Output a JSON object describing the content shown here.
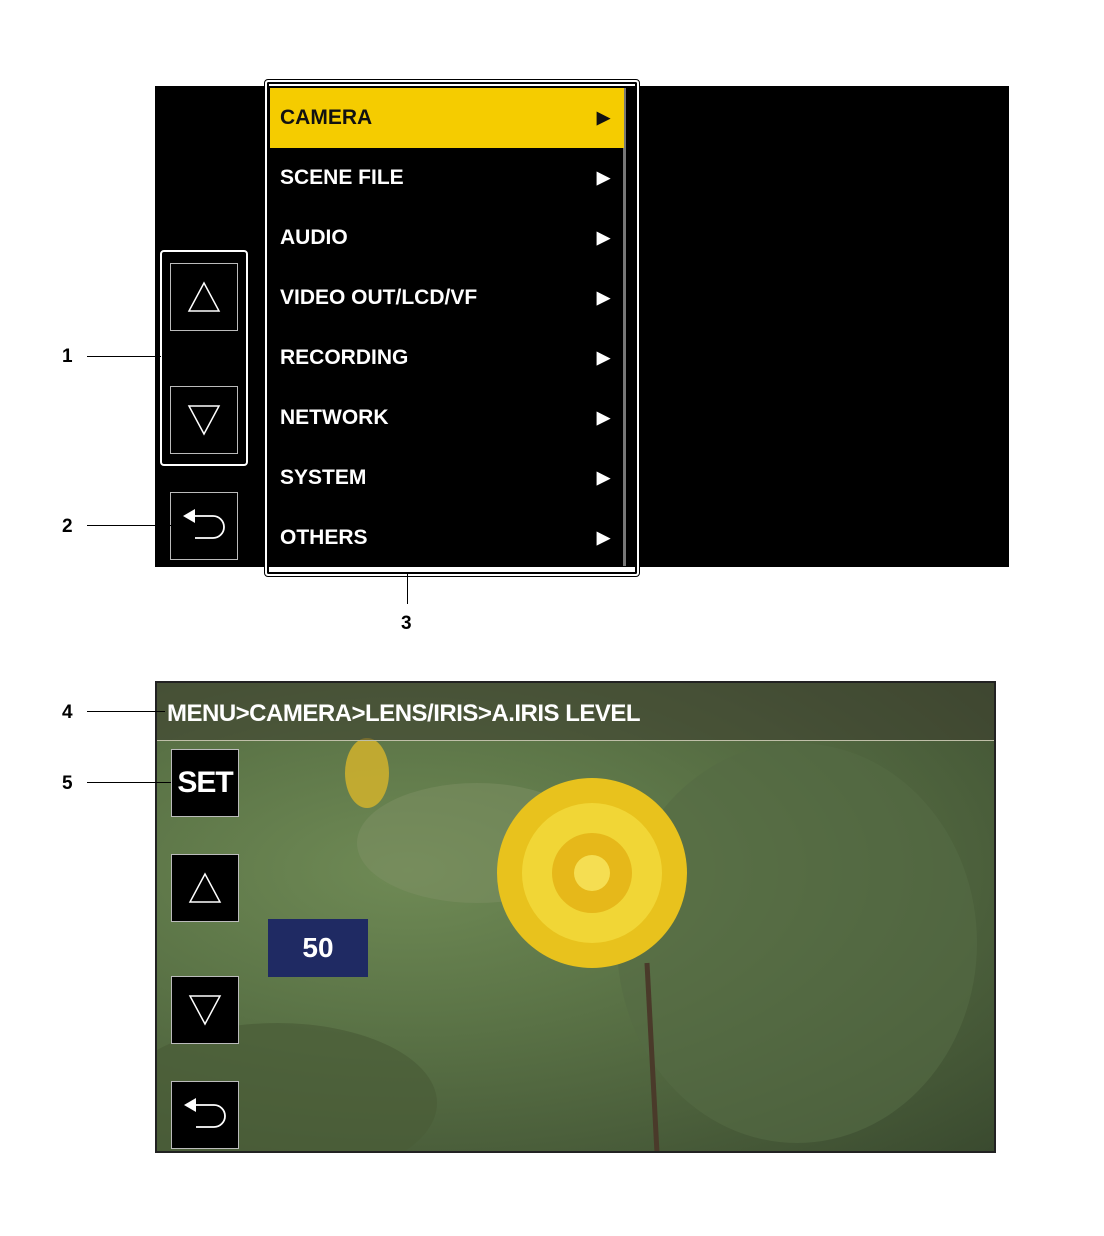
{
  "top_screen": {
    "menu": {
      "items": [
        {
          "label": "CAMERA",
          "arrow": "▶",
          "selected": true
        },
        {
          "label": "SCENE FILE",
          "arrow": "▶",
          "selected": false
        },
        {
          "label": "AUDIO",
          "arrow": "▶",
          "selected": false
        },
        {
          "label": "VIDEO OUT/LCD/VF",
          "arrow": "▶",
          "selected": false
        },
        {
          "label": "RECORDING",
          "arrow": "▶",
          "selected": false
        },
        {
          "label": "NETWORK",
          "arrow": "▶",
          "selected": false
        },
        {
          "label": "SYSTEM",
          "arrow": "▶",
          "selected": false
        },
        {
          "label": "OTHERS",
          "arrow": "▶",
          "selected": false
        }
      ],
      "selected_color": "#f5cc00"
    },
    "buttons": {
      "up_icon": "triangle-up-icon",
      "down_icon": "triangle-down-icon",
      "back_icon": "return-arrow-icon"
    }
  },
  "bottom_screen": {
    "breadcrumb": "MENU>CAMERA>LENS/IRIS>A.IRIS LEVEL",
    "set_label": "SET",
    "value": "50",
    "value_bg_color": "#1f2a63"
  },
  "callouts": {
    "c1": "1",
    "c2": "2",
    "c3": "3",
    "c4": "4",
    "c5": "5"
  }
}
